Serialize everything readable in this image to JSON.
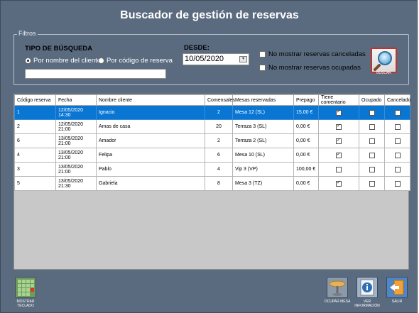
{
  "window": {
    "title": "Buscador de gestión de reservas"
  },
  "filtros": {
    "legend": "Filtros",
    "tipo_label": "TIPO DE BÚSQUEDA",
    "radio_cliente": {
      "label": "Por nombre del cliente",
      "selected": true
    },
    "radio_codigo": {
      "label": "Por código de reserva",
      "selected": false
    },
    "search_value": "",
    "desde_label": "DESDE:",
    "desde_value": "10/05/2020",
    "check_canceladas": {
      "label": "No mostrar reservas canceladas",
      "checked": false
    },
    "check_ocupadas": {
      "label": "No mostrar reservas ocupadas",
      "checked": false
    },
    "buscar_label": "BUSCAR"
  },
  "table": {
    "columns": [
      "Código reserva",
      "Fecha",
      "Nombre cliente",
      "Comensales",
      "Mesas reservadas",
      "Prepago",
      "Tiene comentario",
      "Ocupado",
      "Cancelado"
    ],
    "rows": [
      {
        "codigo": "1",
        "fecha": "12/05/2020 14:30",
        "cliente": "Ignacio",
        "comensales": "2",
        "mesas": "Mesa 12 (SL)",
        "prepago": "15,00 €",
        "comentario": true,
        "ocupado": false,
        "cancelado": false,
        "selected": true
      },
      {
        "codigo": "2",
        "fecha": "12/05/2020 21:00",
        "cliente": "Amas de casa",
        "comensales": "20",
        "mesas": "Terraza 3 (SL)",
        "prepago": "0,00 €",
        "comentario": true,
        "ocupado": false,
        "cancelado": false,
        "selected": false
      },
      {
        "codigo": "6",
        "fecha": "13/05/2020 21:00",
        "cliente": "Amador",
        "comensales": "2",
        "mesas": "Terraza 2 (SL)",
        "prepago": "0,00 €",
        "comentario": true,
        "ocupado": false,
        "cancelado": false,
        "selected": false
      },
      {
        "codigo": "4",
        "fecha": "13/05/2020 21:00",
        "cliente": "Felipa",
        "comensales": "6",
        "mesas": "Mesa 10 (SL)",
        "prepago": "0,00 €",
        "comentario": true,
        "ocupado": false,
        "cancelado": false,
        "selected": false
      },
      {
        "codigo": "3",
        "fecha": "13/05/2020 21:00",
        "cliente": "Pablo",
        "comensales": "4",
        "mesas": "Vip 3 (VP)",
        "prepago": "100,00 €",
        "comentario": false,
        "ocupado": false,
        "cancelado": false,
        "selected": false
      },
      {
        "codigo": "5",
        "fecha": "13/05/2020 21:30",
        "cliente": "Gabriela",
        "comensales": "8",
        "mesas": "Mesa 3 (TZ)",
        "prepago": "0,00 €",
        "comentario": true,
        "ocupado": false,
        "cancelado": false,
        "selected": false
      }
    ]
  },
  "bottom": {
    "teclado_label": "MOSTRAR TECLADO",
    "ocupar_label": "OCUPAR MESA",
    "info_label": "VER INFORMACIÓN",
    "salir_label": "SALIR"
  },
  "colors": {
    "background": "#5a6b80",
    "selected_row": "#0a76d3",
    "buscar_border": "#c4332a"
  }
}
